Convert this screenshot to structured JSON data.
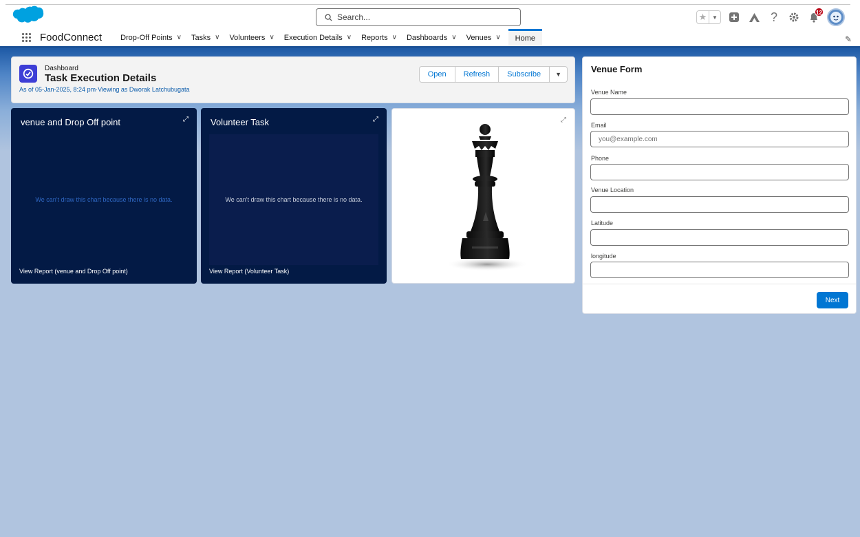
{
  "header": {
    "search_placeholder": "Search...",
    "notification_count": "12"
  },
  "nav": {
    "app_name": "FoodConnect",
    "items": [
      {
        "label": "Drop-Off Points",
        "has_menu": true
      },
      {
        "label": "Tasks",
        "has_menu": true
      },
      {
        "label": "Volunteers",
        "has_menu": true
      },
      {
        "label": "Execution Details",
        "has_menu": true
      },
      {
        "label": "Reports",
        "has_menu": true
      },
      {
        "label": "Dashboards",
        "has_menu": true
      },
      {
        "label": "Venues",
        "has_menu": true
      },
      {
        "label": "Home",
        "has_menu": false
      }
    ],
    "active": "Home"
  },
  "dashboard": {
    "type_label": "Dashboard",
    "title": "Task Execution Details",
    "meta": "As of 05-Jan-2025, 8:24 pm·Viewing as Dworak Latchubugata",
    "buttons": {
      "open": "Open",
      "refresh": "Refresh",
      "subscribe": "Subscribe"
    }
  },
  "widgets": [
    {
      "title": "venue and Drop Off point",
      "empty_message": "We can't draw this chart because there is no data.",
      "report_link": "View Report (venue and Drop Off point)"
    },
    {
      "title": "Volunteer Task",
      "empty_message": "We can't draw this chart because there is no data.",
      "report_link": "View Report (Volunteer Task)"
    },
    {
      "image": "chess-queen-icon"
    }
  ],
  "venue_form": {
    "title": "Venue Form",
    "fields": [
      {
        "label": "Venue Name",
        "value": "",
        "placeholder": ""
      },
      {
        "label": "Email",
        "value": "",
        "placeholder": "you@example.com"
      },
      {
        "label": "Phone",
        "value": "",
        "placeholder": ""
      },
      {
        "label": "Venue Location",
        "value": "",
        "placeholder": ""
      },
      {
        "label": "Latitude",
        "value": "",
        "placeholder": ""
      },
      {
        "label": "longitude",
        "value": "",
        "placeholder": ""
      }
    ],
    "next_label": "Next"
  },
  "colors": {
    "brand": "#0176d3",
    "nav_accent": "#1b5297",
    "widget_dark": "#031a45",
    "page_bg": "#b0c4df",
    "badge": "#ba0517"
  }
}
